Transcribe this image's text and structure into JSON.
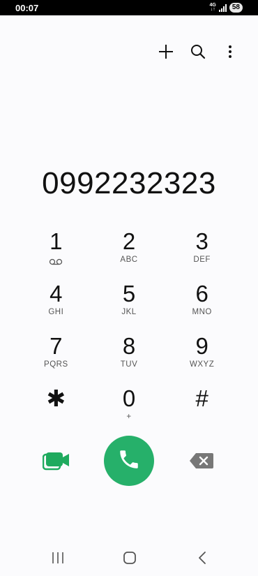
{
  "status_bar": {
    "time": "00:07",
    "network": "4G",
    "network_sub": "↓↑",
    "battery": "58"
  },
  "toolbar": {
    "add_icon": "plus-icon",
    "search_icon": "search-icon",
    "more_icon": "more-vert-icon"
  },
  "dialer": {
    "number": "0992232323"
  },
  "keypad": {
    "keys": [
      {
        "digit": "1",
        "letters": "",
        "sub_icon": "voicemail-icon"
      },
      {
        "digit": "2",
        "letters": "ABC"
      },
      {
        "digit": "3",
        "letters": "DEF"
      },
      {
        "digit": "4",
        "letters": "GHI"
      },
      {
        "digit": "5",
        "letters": "JKL"
      },
      {
        "digit": "6",
        "letters": "MNO"
      },
      {
        "digit": "7",
        "letters": "PQRS"
      },
      {
        "digit": "8",
        "letters": "TUV"
      },
      {
        "digit": "9",
        "letters": "WXYZ"
      },
      {
        "digit": "✱",
        "letters": ""
      },
      {
        "digit": "0",
        "letters": "+"
      },
      {
        "digit": "#",
        "letters": ""
      }
    ]
  },
  "actions": {
    "video_icon": "video-call-icon",
    "call_icon": "phone-icon",
    "backspace_icon": "backspace-icon",
    "call_color": "#26b06a",
    "video_color": "#1faa5e"
  },
  "navigation": {
    "recent_icon": "recent-apps-icon",
    "home_icon": "home-icon",
    "back_icon": "back-icon"
  }
}
